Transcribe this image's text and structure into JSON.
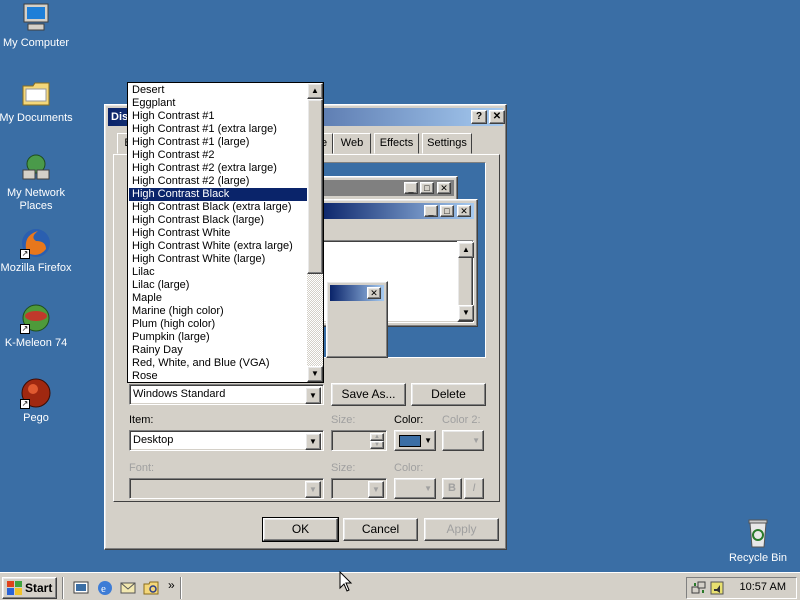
{
  "desktop": {
    "icons": [
      {
        "label": "My Computer",
        "icon": "computer-icon"
      },
      {
        "label": "My Documents",
        "icon": "folder-icon"
      },
      {
        "label": "My Network Places",
        "icon": "network-icon"
      },
      {
        "label": "Mozilla Firefox",
        "icon": "firefox-icon"
      },
      {
        "label": "K-Meleon 74",
        "icon": "kmeleon-icon"
      },
      {
        "label": "Pego",
        "icon": "pego-icon"
      },
      {
        "label": "Recycle Bin",
        "icon": "recycle-bin-icon"
      }
    ]
  },
  "dialog": {
    "title": "Disp",
    "tabs": [
      "B",
      "e",
      "Web",
      "Effects",
      "Settings"
    ],
    "title_buttons": {
      "help": "?",
      "close": "✕"
    },
    "preview": {
      "min": "_",
      "max": "□",
      "close": "✕"
    },
    "scheme_value": "Windows Standard",
    "save_as": "Save As...",
    "delete": "Delete",
    "item_label": "Item:",
    "item_value": "Desktop",
    "size_label": "Size:",
    "color_label": "Color:",
    "color2_label": "Color 2:",
    "font_label": "Font:",
    "size2_label": "Size:",
    "color3_label": "Color:",
    "bold": "B",
    "italic": "I",
    "ok": "OK",
    "cancel": "Cancel",
    "apply": "Apply",
    "desktop_color": "#3a6ea5"
  },
  "scheme_list": {
    "items": [
      "Desert",
      "Eggplant",
      "High Contrast #1",
      "High Contrast #1 (extra large)",
      "High Contrast #1 (large)",
      "High Contrast #2",
      "High Contrast #2 (extra large)",
      "High Contrast #2 (large)",
      "High Contrast Black",
      "High Contrast Black (extra large)",
      "High Contrast Black (large)",
      "High Contrast White",
      "High Contrast White (extra large)",
      "High Contrast White (large)",
      "Lilac",
      "Lilac (large)",
      "Maple",
      "Marine (high color)",
      "Plum (high color)",
      "Pumpkin (large)",
      "Rainy Day",
      "Red, White, and Blue (VGA)",
      "Rose"
    ],
    "selected_index": 8
  },
  "taskbar": {
    "start": "Start",
    "quicklaunch": [
      "show-desktop-icon",
      "ie-icon",
      "outlook-icon",
      "explorer-icon"
    ],
    "chevron": "»",
    "clock": "10:57 AM"
  },
  "colors": {
    "desktop": "#3a6ea5",
    "titlebar_start": "#0a246a",
    "titlebar_end": "#a6caf0",
    "selection": "#0a246a",
    "face": "#d4d0c8"
  }
}
